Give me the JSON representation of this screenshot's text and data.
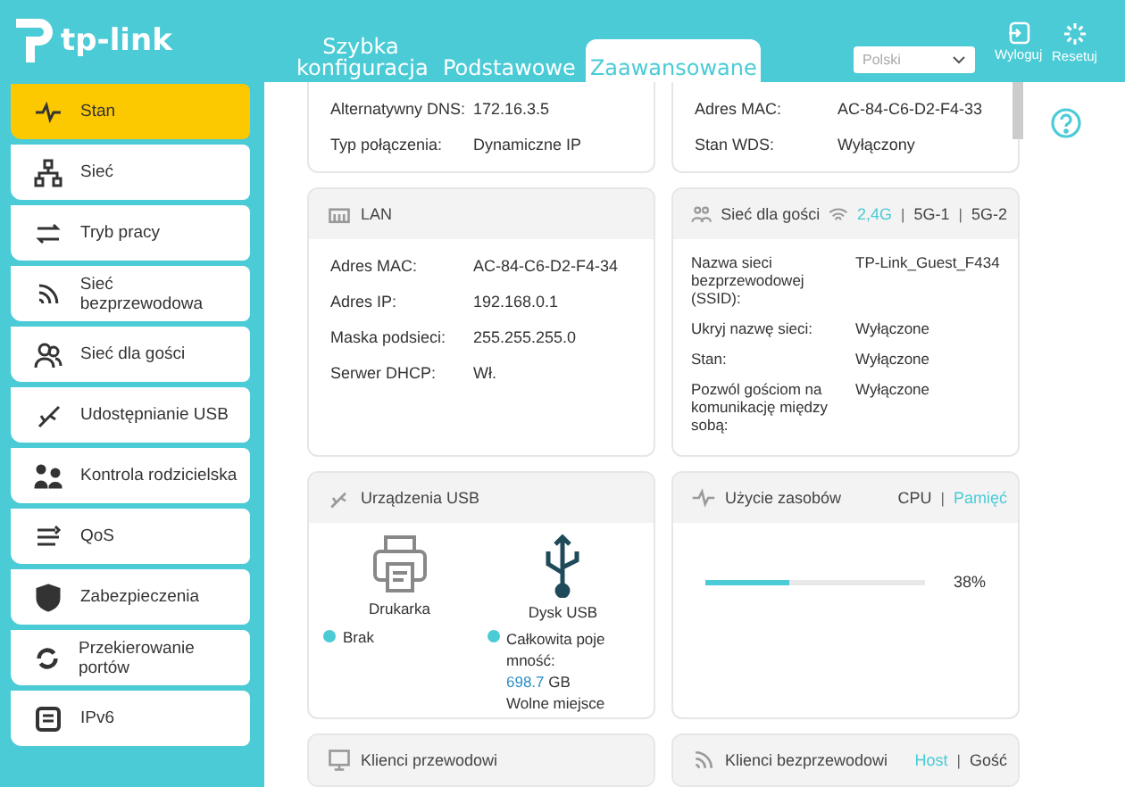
{
  "header": {
    "logo": "tp-link",
    "tabs": [
      {
        "label": "Szybka konfiguracja",
        "selected": false
      },
      {
        "label": "Podstawowe",
        "selected": false
      },
      {
        "label": "Zaawansowane",
        "selected": true
      }
    ],
    "language": "Polski",
    "actions": [
      "Wyloguj",
      "Resetuj"
    ]
  },
  "sidebar": {
    "items": [
      {
        "label": "Stan",
        "selected": true
      },
      {
        "label": "Sieć",
        "selected": false
      },
      {
        "label": "Tryb pracy",
        "selected": false
      },
      {
        "label": "Sieć bezprzewodowa",
        "selected": false
      },
      {
        "label": "Sieć dla gości",
        "selected": false
      },
      {
        "label": "Udostępnianie USB",
        "selected": false
      },
      {
        "label": "Kontrola rodzicielska",
        "selected": false
      },
      {
        "label": "QoS",
        "selected": false
      },
      {
        "label": "Zabezpieczenia",
        "selected": false
      },
      {
        "label": "Przekierowanie portów",
        "selected": false
      },
      {
        "label": "IPv6",
        "selected": false
      }
    ]
  },
  "internet_card": {
    "rows": [
      {
        "label": "Alternatywny DNS:",
        "value": "172.16.3.5"
      },
      {
        "label": "Typ połączenia:",
        "value": "Dynamiczne IP"
      }
    ]
  },
  "wireless_card": {
    "rows": [
      {
        "label": "Adres MAC:",
        "value": "AC-84-C6-D2-F4-33"
      },
      {
        "label": "Stan WDS:",
        "value": "Wyłączony"
      }
    ]
  },
  "lan_card": {
    "title": "LAN",
    "rows": [
      {
        "label": "Adres MAC:",
        "value": "AC-84-C6-D2-F4-34"
      },
      {
        "label": "Adres IP:",
        "value": "192.168.0.1"
      },
      {
        "label": "Maska podsieci:",
        "value": "255.255.255.0"
      },
      {
        "label": "Serwer DHCP:",
        "value": "Wł."
      }
    ]
  },
  "guest_card": {
    "title": "Sieć dla gości",
    "separator": "|",
    "bands": [
      {
        "label": "2,4G",
        "selected": true
      },
      {
        "label": "5G-1",
        "selected": false
      },
      {
        "label": "5G-2",
        "selected": false
      }
    ],
    "rows": [
      {
        "label": "Nazwa sieci bezprzewodowej (SSID):",
        "value": "TP-Link_Guest_F434"
      },
      {
        "label": "Ukryj nazwę sieci:",
        "value": "Wyłączone"
      },
      {
        "label": "Stan:",
        "value": "Wyłączone"
      },
      {
        "label": "Pozwól gościom na komunikację między sobą:",
        "value": "Wyłączone"
      }
    ]
  },
  "usb_card": {
    "title": "Urządzenia USB",
    "printer": {
      "name": "Drukarka",
      "status": "Brak"
    },
    "disk": {
      "name": "Dysk USB",
      "capacity_label": "Całkowita pojemność:",
      "capacity_value": "698.7",
      "capacity_unit": "GB",
      "free_label": "Wolne miejsce"
    }
  },
  "usage_card": {
    "title": "Użycie zasobów",
    "separator": "|",
    "modes": [
      {
        "label": "CPU",
        "selected": false
      },
      {
        "label": "Pamięć",
        "selected": true
      }
    ],
    "level": 0.38,
    "reading": "38%"
  },
  "wired_clients_card": {
    "title": "Klienci przewodowi"
  },
  "wireless_clients_card": {
    "title": "Klienci bezprzewodowi",
    "separator": "|",
    "modes": [
      {
        "label": "Host",
        "selected": true
      },
      {
        "label": "Gość",
        "selected": false
      }
    ]
  }
}
